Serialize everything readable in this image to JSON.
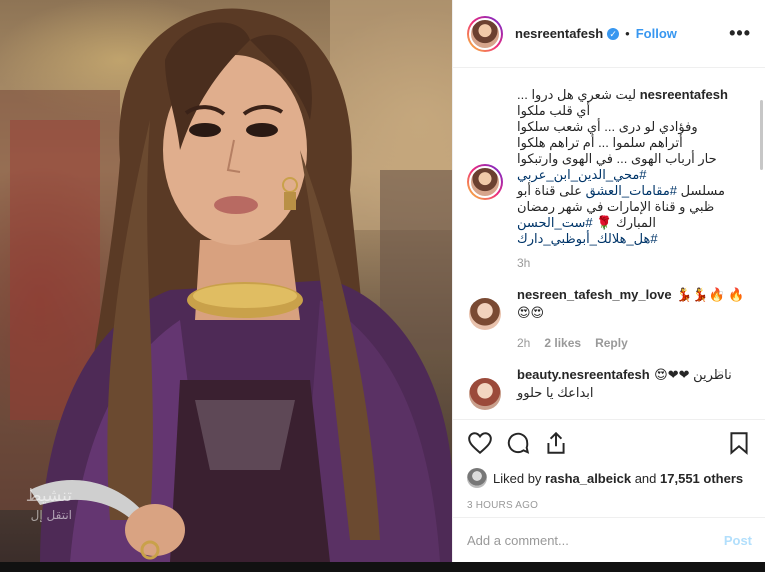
{
  "post": {
    "username": "nesreentafesh",
    "verified_icon": "verified-badge-icon",
    "separator": "•",
    "follow_label": "Follow",
    "more_icon": "more-options-icon"
  },
  "caption": {
    "username": "nesreentafesh",
    "lines": [
      "ليت شعري هل دروا ... أي قلب ملكوا",
      "وفؤادي لو درى ... أي شعب سلكوا",
      "أتراهم سلموا ... أم تراهم هلكوا",
      "حار أرباب الهوى ... في الهوى وارتبكوا"
    ],
    "hashtag1": "#محي_الدين_ابن_عربي",
    "text2": "مسلسل",
    "hashtag2": "#مقامات_العشق",
    "text3": "على قناة أبو ظبي و قناة الإمارات في شهر رمضان المبارك 🌹",
    "hashtag3": "#ست_الحسن",
    "hashtag4": "#هل_هلالك_أبوظبي_دارك",
    "time": "3h"
  },
  "comments": [
    {
      "username": "nesreen_tafesh_my_love",
      "text": "💃💃🔥 🔥😍😍",
      "time": "2h",
      "likes": "2 likes",
      "reply": "Reply"
    },
    {
      "username": "beauty.nesreentafesh",
      "text": "ناطرين ❤❤😍 ابداعك يا حلوو"
    }
  ],
  "likes": {
    "prefix": "Liked by",
    "user": "rasha_albeick",
    "mid": "and",
    "count": "17,551 others"
  },
  "timestamp": "3 HOURS AGO",
  "add_comment": {
    "placeholder": "Add a comment...",
    "post_label": "Post"
  },
  "watermark": {
    "title": "تنشيط",
    "sub": "انتقل إل"
  }
}
